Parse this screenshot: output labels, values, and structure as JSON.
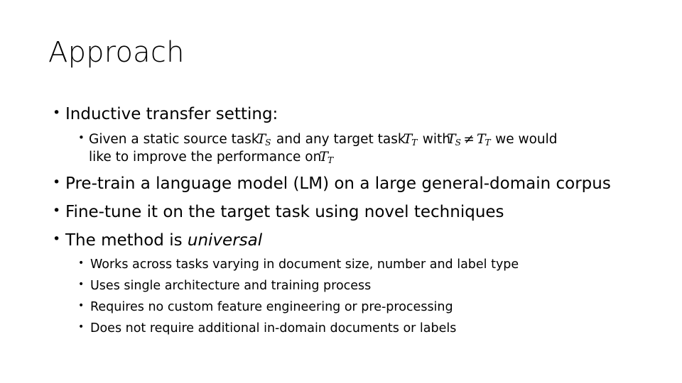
{
  "slide": {
    "title": "Approach",
    "background_color": "#ffffff",
    "text_color": "#000000"
  },
  "bullets": {
    "b1": {
      "marker": "•",
      "text": "Inductive transfer setting:"
    },
    "b1_sub": {
      "marker": "•",
      "line1_part1": "Given a static source task",
      "math_ts_1": {
        "symbol": "T",
        "subscript": "S"
      },
      "line1_part2": "and any target task",
      "math_tt_1": {
        "symbol": "T",
        "subscript": "T"
      },
      "line1_part3": "with",
      "math_ts_2": {
        "symbol": "T",
        "subscript": "S"
      },
      "operator": "≠",
      "math_tt_2": {
        "symbol": "T",
        "subscript": "T"
      },
      "line1_part4": "we would",
      "line2_part1": "like to improve the performance on",
      "math_tt_3": {
        "symbol": "T",
        "subscript": "T"
      }
    },
    "b2": {
      "marker": "•",
      "text": "Pre-train a language model (LM) on a large general-domain corpus"
    },
    "b3": {
      "marker": "•",
      "text": "Fine-tune it on the target task using novel techniques"
    },
    "b4": {
      "marker": "•",
      "text_plain": "The method is ",
      "text_italic": "universal"
    },
    "b4_subs": [
      {
        "marker": "•",
        "text": "Works across tasks varying in document size, number and label type"
      },
      {
        "marker": "•",
        "text": "Uses single architecture and training process"
      },
      {
        "marker": "•",
        "text": "Requires no custom feature engineering or pre-processing"
      },
      {
        "marker": "•",
        "text": "Does not require additional in-domain documents or labels"
      }
    ]
  }
}
